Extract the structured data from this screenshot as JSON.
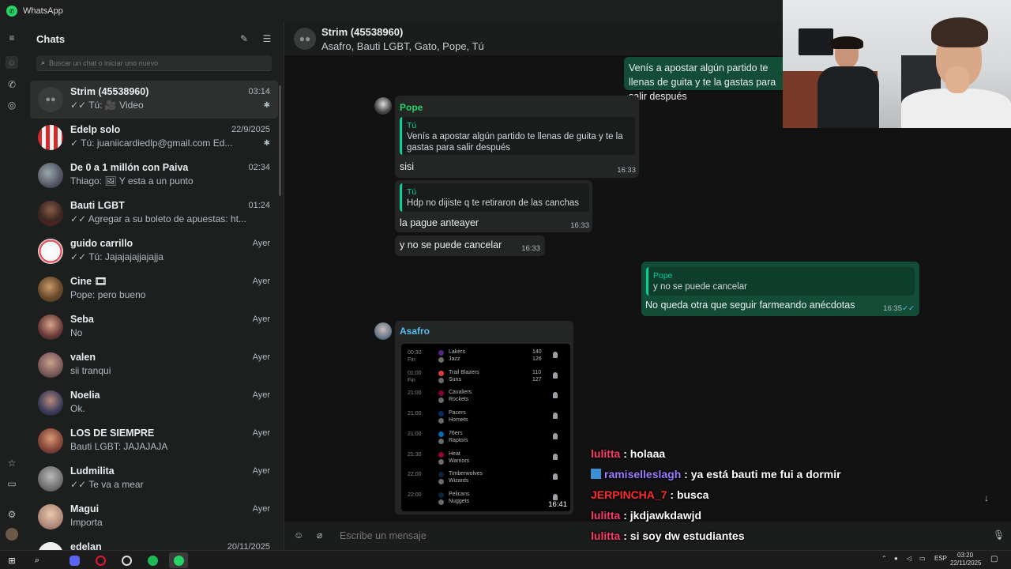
{
  "window": {
    "title": "WhatsApp"
  },
  "sidebar": {
    "title": "Chats",
    "search_placeholder": "Buscar un chat o iniciar uno nuevo",
    "chats": [
      {
        "name": "Strim (45538960)",
        "time": "03:14",
        "preview": "✓✓ Tú: 🎥 Video",
        "pinned": true,
        "active": true
      },
      {
        "name": "Edelp solo",
        "time": "22/9/2025",
        "preview": "✓ Tú: juaniicardiedlp@gmail.com  Ed...",
        "pinned": true
      },
      {
        "name": "De 0 a 1 millón con Paiva",
        "time": "02:34",
        "preview": "Thiago: 🖼 Y esta a un punto"
      },
      {
        "name": "Bauti LGBT",
        "time": "01:24",
        "preview": "✓✓ Agregar a su boleto de apuestas:  ht..."
      },
      {
        "name": "guido carrillo",
        "time": "Ayer",
        "preview": "✓✓ Tú: Jajajajajjajajja"
      },
      {
        "name": "Cine 🎞",
        "time": "Ayer",
        "preview": "Pope: pero bueno"
      },
      {
        "name": "Seba",
        "time": "Ayer",
        "preview": "No"
      },
      {
        "name": "valen",
        "time": "Ayer",
        "preview": "sii tranqui"
      },
      {
        "name": "Noelia",
        "time": "Ayer",
        "preview": "Ok."
      },
      {
        "name": "LOS DE SIEMPRE",
        "time": "Ayer",
        "preview": "Bauti LGBT: JAJAJAJA"
      },
      {
        "name": "Ludmilita",
        "time": "Ayer",
        "preview": "✓✓ Te va a mear"
      },
      {
        "name": "Magui",
        "time": "Ayer",
        "preview": "Importa"
      },
      {
        "name": "edelan",
        "time": "20/11/2025",
        "preview": ""
      }
    ]
  },
  "conversation": {
    "name": "Strim (45538960)",
    "members": "Asafro, Bauti LGBT, Gato, Pope, Tú",
    "messages": {
      "m1_text": "Venís a apostar algún partido te llenas de guita y te la gastas para salir después",
      "m2_sender": "Pope",
      "m2_quote_author": "Tú",
      "m2_quote": "Venís a apostar algún partido te llenas de guita y te la gastas para salir después",
      "m2_text": "sisi",
      "m2_time": "16:33",
      "m3_quote_author": "Tú",
      "m3_quote": "Hdp no dijiste q te retiraron de las canchas",
      "m3_text": "la pague anteayer",
      "m3_time": "16:33",
      "m4_text": "y no se puede cancelar",
      "m4_time": "16:33",
      "m5_quote_author": "Pope",
      "m5_quote": "y no se puede cancelar",
      "m5_text": "No queda otra que seguir farmeando anécdotas",
      "m5_time": "16:35",
      "m6_sender": "Asafro",
      "m6_time": "16:41"
    },
    "image_games": [
      {
        "time": "00:30",
        "status": "Fin",
        "team1": "Lakers",
        "team2": "Jazz",
        "score1": "140",
        "score2": "126"
      },
      {
        "time": "01:00",
        "status": "Fin",
        "team1": "Trail Blazers",
        "team2": "Suns",
        "score1": "110",
        "score2": "127"
      },
      {
        "time": "21:00",
        "status": "",
        "team1": "Cavaliers",
        "team2": "Rockets",
        "score1": "",
        "score2": ""
      },
      {
        "time": "21:00",
        "status": "",
        "team1": "Pacers",
        "team2": "Hornets",
        "score1": "",
        "score2": ""
      },
      {
        "time": "21:00",
        "status": "",
        "team1": "76ers",
        "team2": "Raptors",
        "score1": "",
        "score2": ""
      },
      {
        "time": "21:30",
        "status": "",
        "team1": "Heat",
        "team2": "Warriors",
        "score1": "",
        "score2": ""
      },
      {
        "time": "22:00",
        "status": "",
        "team1": "Timberwolves",
        "team2": "Wizards",
        "score1": "",
        "score2": ""
      },
      {
        "time": "22:00",
        "status": "",
        "team1": "Pelicans",
        "team2": "Nuggets",
        "score1": "",
        "score2": ""
      }
    ],
    "composer_placeholder": "Escribe un mensaje"
  },
  "stream_chat": [
    {
      "user": "lulitta",
      "color": "#ff3b6b",
      "text": "holaaa"
    },
    {
      "user": "ramiselleslagh",
      "color": "#9b7bff",
      "text": "ya está bauti me fui a dormir"
    },
    {
      "user": "JERPINCHA_7",
      "color": "#ff2b2b",
      "text": "busca"
    },
    {
      "user": "lulitta",
      "color": "#ff3b6b",
      "text": "jkdjawkdawjd"
    },
    {
      "user": "lulitta",
      "color": "#ff3b6b",
      "text": "si soy dw estudiantes"
    }
  ],
  "taskbar": {
    "language": "ESP",
    "time": "03:20",
    "date": "22/11/2025"
  },
  "colors": {
    "accent": "#25d366",
    "outgoing_bubble": "#144d37",
    "incoming_bubble": "#242626",
    "pope_name": "#25d366",
    "asafro_name": "#53bdeb"
  }
}
